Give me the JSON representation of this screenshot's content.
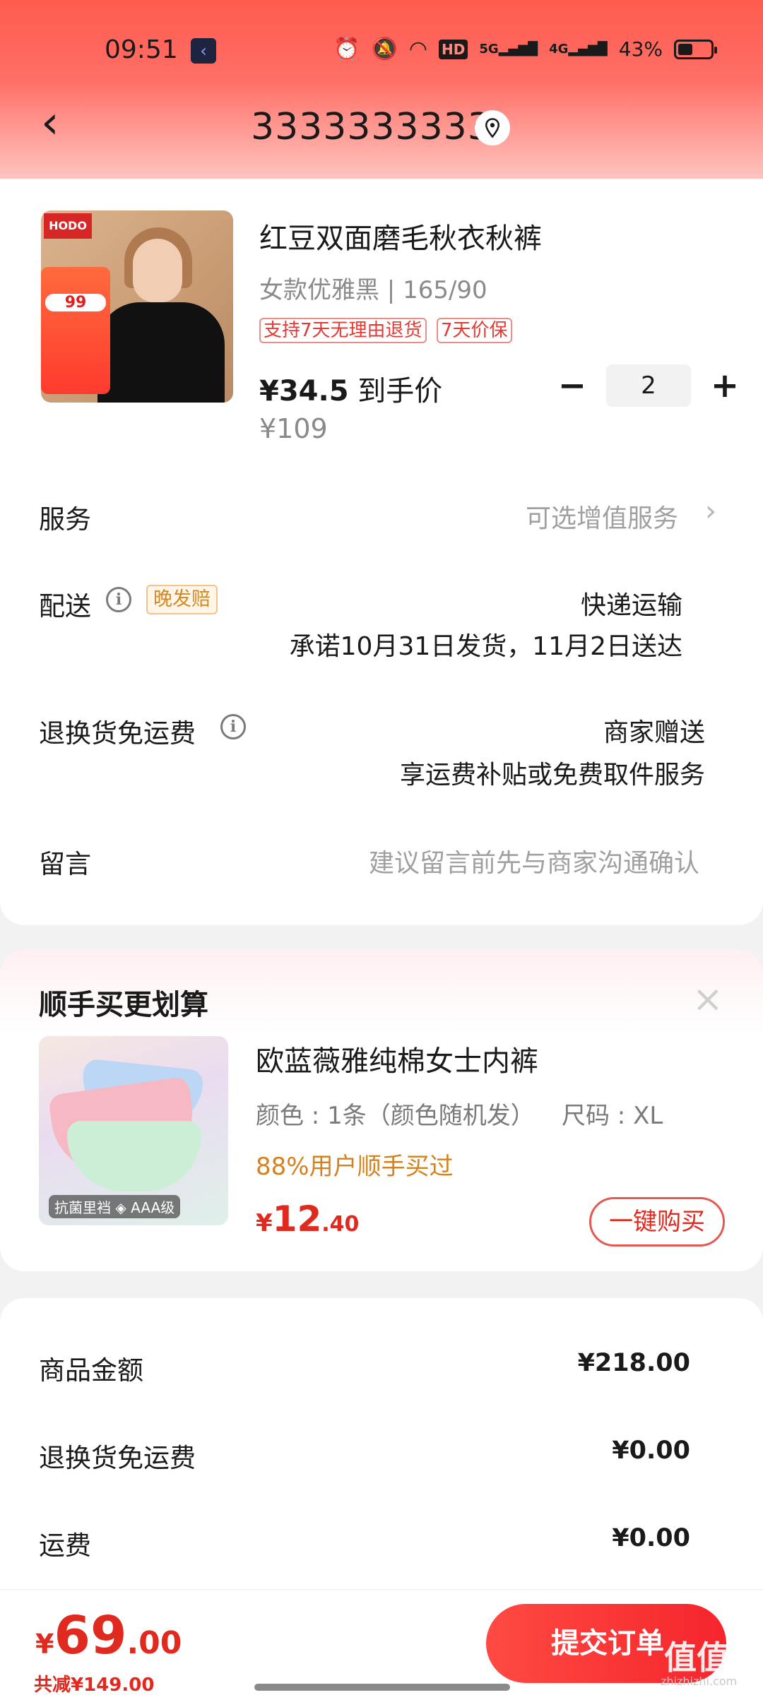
{
  "status_bar": {
    "time": "09:51",
    "network_hd": "HD",
    "net_5g": "5G",
    "net_4g": "4G",
    "battery_percent": "43%"
  },
  "header": {
    "title": "3333333333"
  },
  "product": {
    "title": "红豆双面磨毛秋衣秋裤",
    "spec": "女款优雅黑 | 165/90",
    "tags": [
      "支持7天无理由退货",
      "7天价保"
    ],
    "price_now": "¥34.5",
    "price_now_suffix": "到手价",
    "price_orig": "¥109",
    "quantity": "2",
    "image": {
      "brand": "HODO",
      "promo_price": "99"
    }
  },
  "service": {
    "label": "服务",
    "value": "可选增值服务"
  },
  "delivery": {
    "label": "配送",
    "tag": "晚发赔",
    "method": "快递运输",
    "promise": "承诺10月31日发货，11月2日送达"
  },
  "return_shipping": {
    "label": "退换货免运费",
    "value": "商家赠送",
    "detail": "享运费补贴或免费取件服务"
  },
  "message": {
    "label": "留言",
    "placeholder": "建议留言前先与商家沟通确认"
  },
  "upsell": {
    "section_title": "顺手买更划算",
    "name": "欧蓝薇雅纯棉女士内裤",
    "spec_color": "颜色 : 1条（颜色随机发）",
    "spec_size": "尺码 : XL",
    "popularity": "88%用户顺手买过",
    "price_symbol": "¥",
    "price_int": "12",
    "price_dec": ".40",
    "buy_label": "一键购买",
    "image_badge": "抗菌里裆 ◈ AAA级"
  },
  "summary": {
    "rows": [
      {
        "label": "商品金额",
        "value": "¥218.00"
      },
      {
        "label": "退换货免运费",
        "value": "¥0.00"
      },
      {
        "label": "运费",
        "value": "¥0.00"
      }
    ]
  },
  "footer": {
    "total_symbol": "¥",
    "total_int": "69",
    "total_dec": ".00",
    "saved": "共减¥149.00",
    "submit_label": "提交订单",
    "watermark": "值值值",
    "watermark_url": "zhizhizhi.com"
  },
  "colors": {
    "accent_red": "#e0291f",
    "header_gradient_top": "#ff5b4e",
    "popularity_orange": "#d4821e"
  }
}
